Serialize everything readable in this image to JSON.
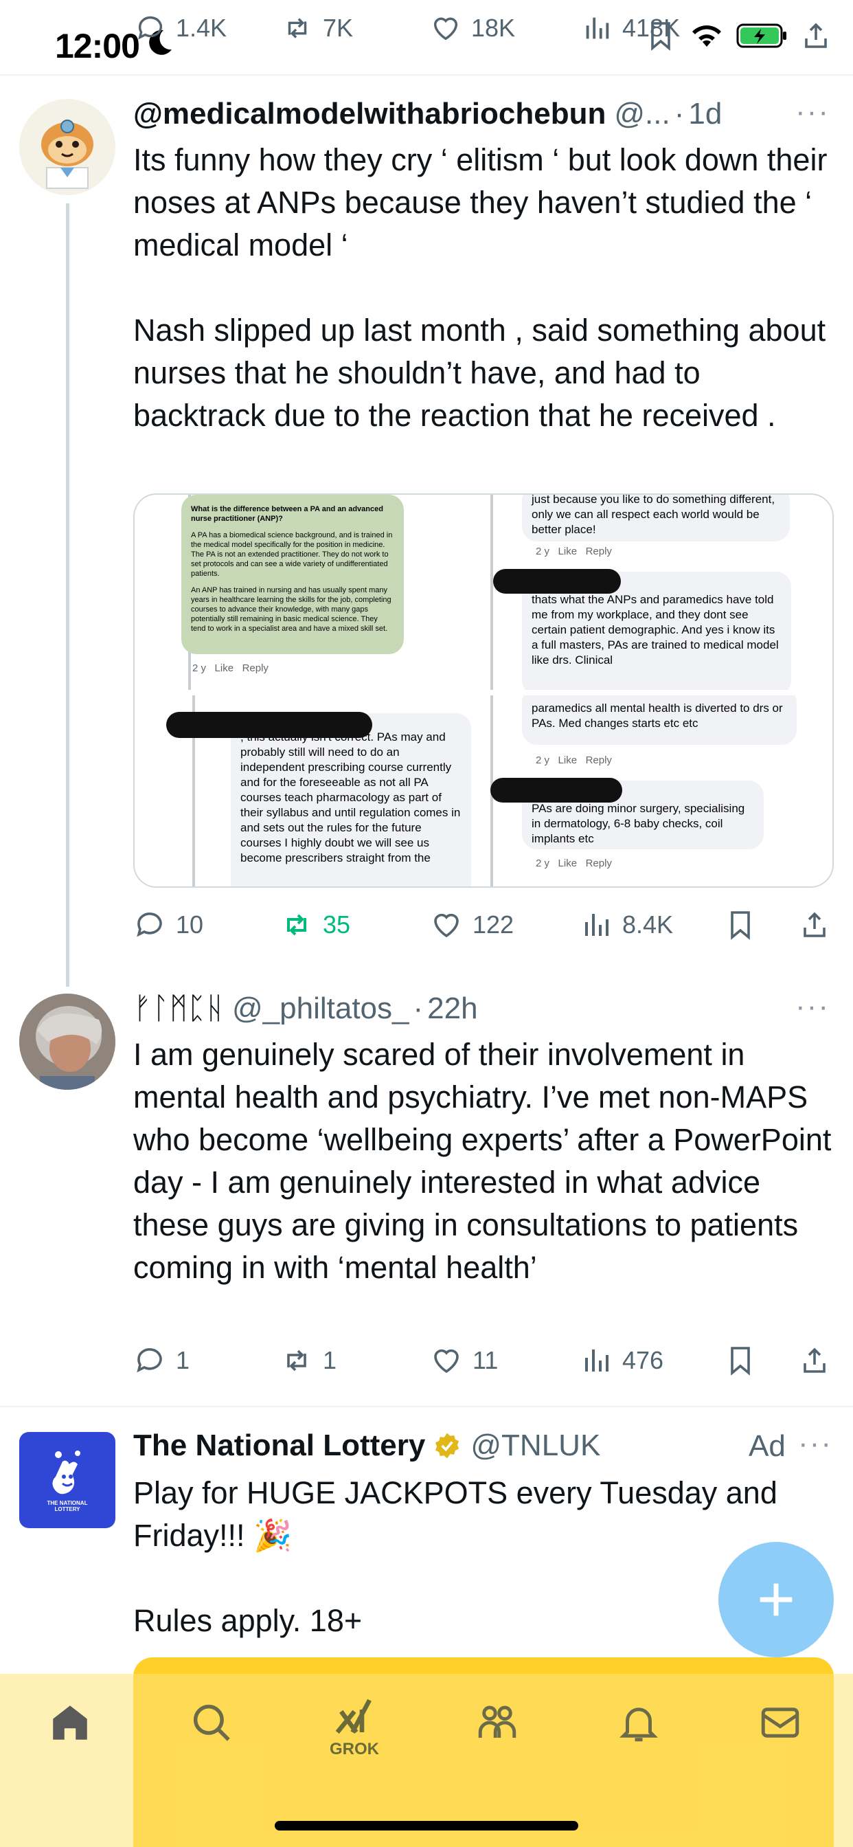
{
  "status_bar": {
    "time": "12:00",
    "top_metrics": {
      "replies": "1.4K",
      "reposts": "7K",
      "likes": "18K",
      "views": "418K"
    }
  },
  "tweets": [
    {
      "name": "@medicalmodelwithabriochebun",
      "handle": "@...",
      "time": "1d",
      "text": "Its funny how they cry ‘ elitism ‘ but look down their noses at ANPs because they haven’t studied the ‘ medical model ‘\n\nNash slipped up last month , said something about nurses that he shouldn’t have, and had to backtrack due to the reaction that he received .",
      "stats": {
        "replies": "10",
        "reposts": "35",
        "likes": "122",
        "views": "8.4K"
      }
    },
    {
      "name": "ᚠᛚᛗᛈᚺ",
      "handle": "@_philtatos_",
      "time": "22h",
      "text": "I am genuinely scared of their involvement in mental health and psychiatry. I’ve met non-MAPS who become ‘wellbeing experts’ after a PowerPoint day - I am genuinely interested in what advice these guys are giving in consultations to patients coming in with ‘mental health’",
      "stats": {
        "replies": "1",
        "reposts": "1",
        "likes": "11",
        "views": "476"
      }
    },
    {
      "name": "The National Lottery",
      "handle": "@TNLUK",
      "ad_label": "Ad",
      "avatar_text": "THE NATIONAL LOTTERY",
      "text": "Play for HUGE JACKPOTS every Tuesday and Friday!!! 🎉\n\nRules apply. 18+"
    }
  ],
  "media": {
    "q1_title": "What is the difference between a PA and an advanced nurse practitioner (ANP)?",
    "q1_body1": "A PA has a biomedical science background, and is trained in the medical model specifically for the position in medicine. The PA is not an extended practitioner. They do not work to set protocols and can see a wide variety of undifferentiated patients.",
    "q1_body2": "An ANP has trained in nursing and has usually spent many years in healthcare learning the skills for the job, completing courses to advance their knowledge, with many gaps potentially still remaining in basic medical science. They tend to work in a specialist area and have a mixed skill set.",
    "q2_top": "just because you like to do something different, only we can all respect each world would be better place!",
    "q2_main": "thats what the ANPs and paramedics have told me from my workplace, and they dont see certain patient demographic. And yes i know its a full masters, PAs are trained to medical model like drs. Clinical",
    "q3_main": ", this actually isn't correct. PAs may and probably still will need to do an independent prescribing course currently and for the foreseeable as not all PA courses teach pharmacology as part of their syllabus and until regulation comes in and sets out the rules for the future courses I highly doubt we will see us become prescribers straight from the",
    "q4_top": "paramedics all mental health is diverted to drs or PAs. Med changes starts etc etc",
    "q4_main": "PAs are doing minor surgery, specialising in dermatology, 6-8 baby checks, coil implants etc",
    "meta_age": "2 y",
    "meta_like": "Like",
    "meta_reply": "Reply"
  },
  "nav": {
    "grok_label": "GROK"
  },
  "colors": {
    "accent": "#1d9bf0",
    "repost_green": "#00ba7c",
    "fab": "#8ecdf8",
    "ad_banner": "#ffcf2a"
  }
}
